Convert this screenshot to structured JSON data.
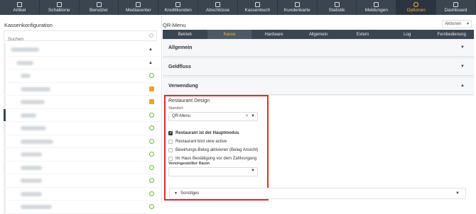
{
  "topnav": [
    {
      "label": "Artikel",
      "icon": "article-icon"
    },
    {
      "label": "Schablone",
      "icon": "template-icon"
    },
    {
      "label": "Benutzer",
      "icon": "users-icon"
    },
    {
      "label": "Mediacenter",
      "icon": "media-icon"
    },
    {
      "label": "Kreditkunden",
      "icon": "credit-customers-icon"
    },
    {
      "label": "Abschlüsse",
      "icon": "closings-icon"
    },
    {
      "label": "Kassenbuch",
      "icon": "cashbook-icon"
    },
    {
      "label": "Kundenkarte",
      "icon": "customer-card-icon"
    },
    {
      "label": "Statistik",
      "icon": "statistics-icon"
    },
    {
      "label": "Meldungen",
      "icon": "messages-icon"
    },
    {
      "label": "Optionen",
      "icon": "gear-icon",
      "active": true
    },
    {
      "label": "Dashboard",
      "icon": "dashboard-icon"
    }
  ],
  "left": {
    "title": "Kassenkonfiguration",
    "search_placeholder": "Suchen"
  },
  "tree_status": [
    "none",
    "none",
    "ok",
    "warn",
    "warn",
    "ok",
    "ok",
    "ok",
    "ok",
    "ok",
    "ok",
    "ok",
    "ok"
  ],
  "right": {
    "title": "QR-Menu",
    "aktionen": "Aktionen",
    "tabs": [
      "Betrieb",
      "Kasse",
      "Hardware",
      "Allgemein",
      "Extern",
      "Log",
      "Fernbedienung"
    ],
    "active_tab": "Kasse",
    "sections": {
      "allgemein": "Allgemein",
      "geldfluss": "Geldfluss",
      "verwendung": "Verwendung"
    },
    "restaurant_design": "Restaurant Design",
    "standort_label": "Standort",
    "standort_value": "QR-Menu",
    "checkboxes": [
      {
        "label": "Restaurant ist der Hauptmodus",
        "checked": true
      },
      {
        "label": "Restaurant bird view active",
        "checked": false
      },
      {
        "label": "Bewirtungs-Beleg aktivieren (Beleg Ansicht)",
        "checked": false
      },
      {
        "label": "Im Haus Bestätigung vor dem Zahlvorgang",
        "checked": false
      }
    ],
    "raum_label": "Voreingestellter Raum",
    "raum_value": "",
    "sonstiges": "Sonstiges"
  }
}
